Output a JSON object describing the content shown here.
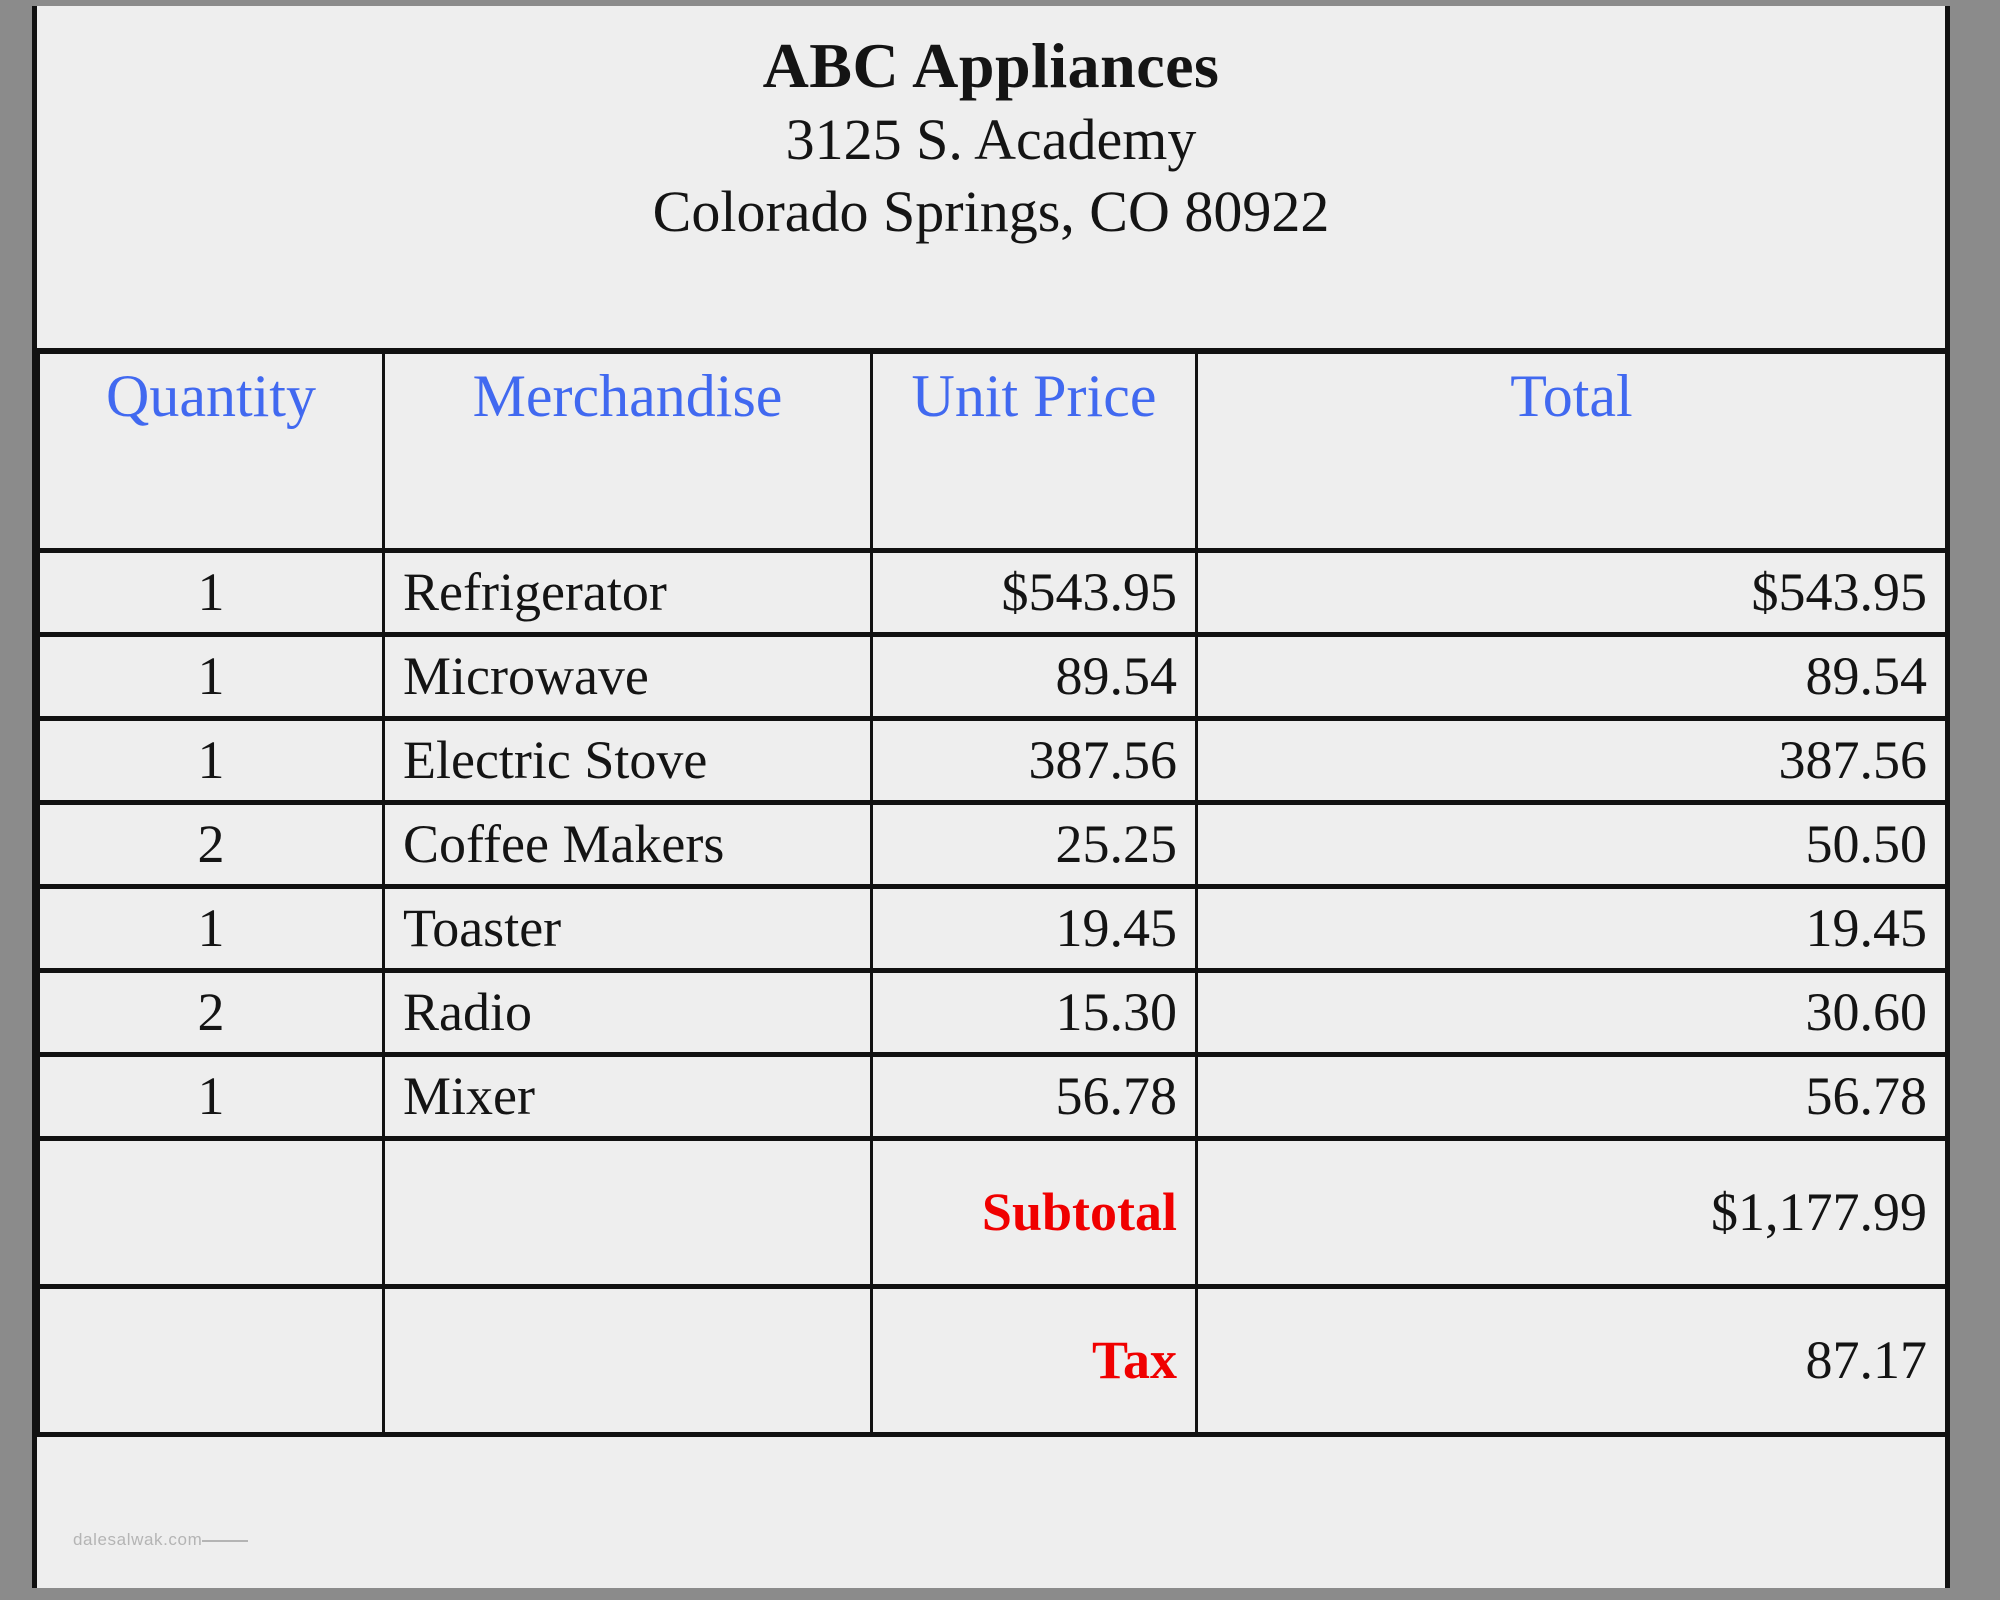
{
  "document": {
    "kind": "invoice",
    "watermark": "dalesalwak.com"
  },
  "letterhead": {
    "store_name": "ABC Appliances",
    "address_line": "3125 S. Academy",
    "city_state_zip": "Colorado Springs, CO 80922"
  },
  "colors": {
    "header_text": "#4169f0",
    "body_text": "#141414",
    "summary_label": "#f00000",
    "page_background": "#eeeeee",
    "border": "#111111",
    "scan_background": "#8b8b8b",
    "watermark": "#b4b4b4"
  },
  "table": {
    "columns": [
      {
        "key": "quantity",
        "label": "Quantity"
      },
      {
        "key": "merchandise",
        "label": "Merchandise"
      },
      {
        "key": "unit_price",
        "label": "Unit Price"
      },
      {
        "key": "total",
        "label": "Total"
      }
    ],
    "rows": [
      {
        "quantity": "1",
        "merchandise": "Refrigerator",
        "unit_price": "$543.95",
        "total": "$543.95"
      },
      {
        "quantity": "1",
        "merchandise": "Microwave",
        "unit_price": "89.54",
        "total": "89.54"
      },
      {
        "quantity": "1",
        "merchandise": "Electric Stove",
        "unit_price": "387.56",
        "total": "387.56"
      },
      {
        "quantity": "2",
        "merchandise": "Coffee Makers",
        "unit_price": "25.25",
        "total": "50.50"
      },
      {
        "quantity": "1",
        "merchandise": "Toaster",
        "unit_price": "19.45",
        "total": "19.45"
      },
      {
        "quantity": "2",
        "merchandise": "Radio",
        "unit_price": "15.30",
        "total": "30.60"
      },
      {
        "quantity": "1",
        "merchandise": "Mixer",
        "unit_price": "56.78",
        "total": "56.78"
      }
    ],
    "summary": [
      {
        "label": "Subtotal",
        "value": "$1,177.99"
      },
      {
        "label": "Tax",
        "value": "87.17"
      }
    ]
  }
}
